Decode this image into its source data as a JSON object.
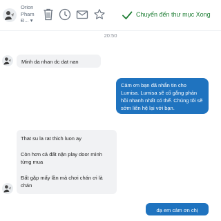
{
  "toolbar": {
    "contact_name_line1": "Orion",
    "contact_name_line2": "Pham",
    "contact_name_sub": "Đ...",
    "dropdown_glyph": "▾",
    "actions": {
      "delete_icon": "trash-icon",
      "snooze_icon": "clock-icon",
      "mark_unread_icon": "mail-icon",
      "star_icon": "star-icon",
      "move_icon": "check-icon"
    },
    "move_label": "Chuyển đến thư mục Xong"
  },
  "conversation": {
    "timestamp": "20:50",
    "messages": [
      {
        "direction": "incoming",
        "text": "Minh da nhan dc dat nan"
      },
      {
        "direction": "outgoing",
        "text": "Cảm ơn bạn đã nhắn tin cho Lumisa. Lumisa sẽ cố gắng phản hồi nhanh nhất có thể. Chúng tôi sẽ sớm liên hệ lại với bạn."
      },
      {
        "direction": "incoming",
        "text": "That su la rat thich luon ay"
      },
      {
        "direction": "incoming",
        "text": "Còn hơn cả đất nặn play door mình từng mua"
      },
      {
        "direction": "incoming",
        "text": "Đất gặp mấy lần mà chơi chán ơi là chán"
      },
      {
        "direction": "outgoing",
        "text": "dạ em cảm ơn chị"
      }
    ]
  },
  "colors": {
    "outgoing_bubble": "#1f73bf",
    "incoming_bubble": "#f1f2f4",
    "move_action": "#1e7e34"
  }
}
